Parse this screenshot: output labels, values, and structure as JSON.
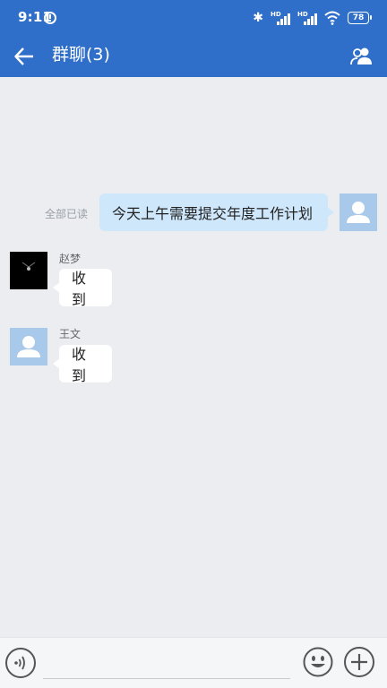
{
  "status_bar": {
    "time": "9:11",
    "signal_label_1": "HD",
    "signal_label_2": "HD",
    "battery": "78"
  },
  "header": {
    "title": "群聊(3)",
    "back_icon": "arrow-left-icon",
    "members_icon": "group-members-icon"
  },
  "messages": [
    {
      "side": "right",
      "text": "今天上午需要提交年度工作计划",
      "read_status": "全部已读",
      "avatar": "default-avatar"
    },
    {
      "side": "left",
      "sender": "赵梦",
      "text": "收到",
      "avatar": "dark-avatar"
    },
    {
      "side": "left",
      "sender": "王文",
      "text": "收到",
      "avatar": "default-avatar"
    }
  ],
  "input_bar": {
    "voice_icon": "voice-icon",
    "text_value": "",
    "emoji_icon": "emoji-icon",
    "plus_icon": "plus-icon"
  },
  "colors": {
    "header_bg": "#2f6fc9",
    "my_bubble": "#cfe7fb",
    "background": "#ebedf1"
  }
}
